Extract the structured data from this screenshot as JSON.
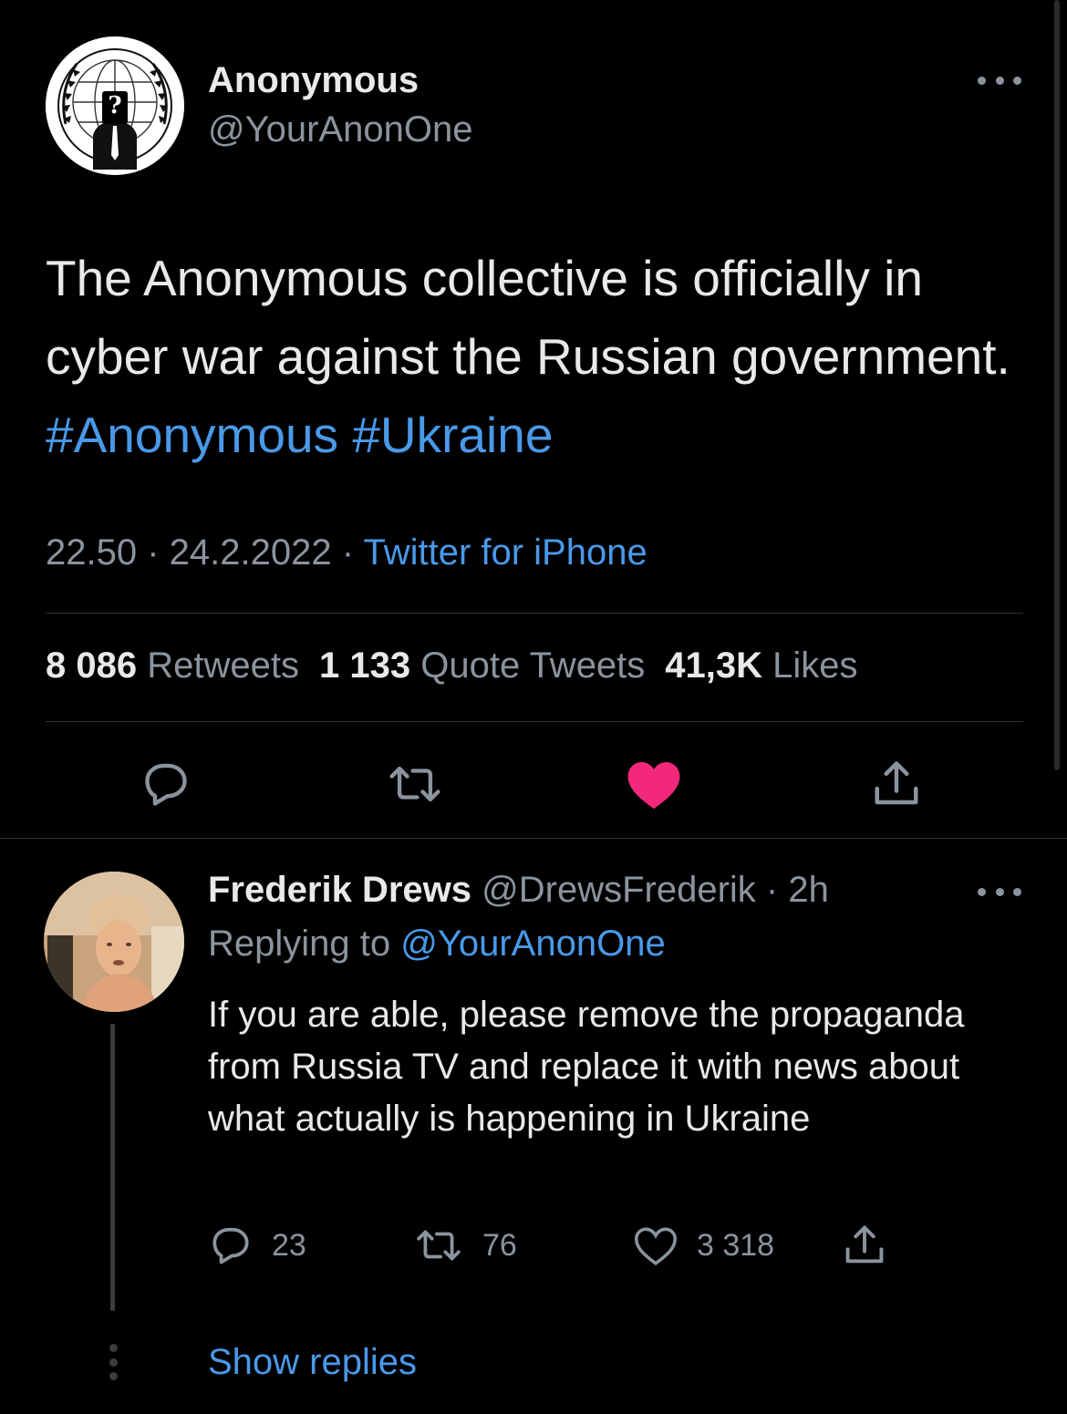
{
  "tweet": {
    "author_name": "Anonymous",
    "author_handle": "@YourAnonOne",
    "text_before": "The Anonymous collective is officially in cyber war against the Russian government.",
    "hashtags": [
      "#Anonymous",
      "#Ukraine"
    ],
    "time": "22.50",
    "date": "24.2.2022",
    "source": "Twitter for iPhone",
    "retweets_count": "8 086",
    "retweets_label": "Retweets",
    "quotes_count": "1 133",
    "quotes_label": "Quote Tweets",
    "likes_count": "41,3K",
    "likes_label": "Likes",
    "liked": true,
    "icons": [
      "reply-icon",
      "retweet-icon",
      "heart-filled-icon",
      "share-icon"
    ]
  },
  "reply": {
    "author_name": "Frederik Drews",
    "author_handle": "@DrewsFrederik",
    "age": "2h",
    "replying_prefix": "Replying to",
    "replying_to": "@YourAnonOne",
    "text": "If you are able, please remove the propaganda from Russia TV and replace it with news about what actually is happening in Ukraine",
    "reply_count": "23",
    "retweet_count": "76",
    "like_count": "3 318"
  },
  "show_replies": "Show replies",
  "colors": {
    "background": "#000000",
    "text": "#e7e9ea",
    "secondary": "#8b949e",
    "accent": "#4a99e9",
    "like": "#f2287a"
  }
}
